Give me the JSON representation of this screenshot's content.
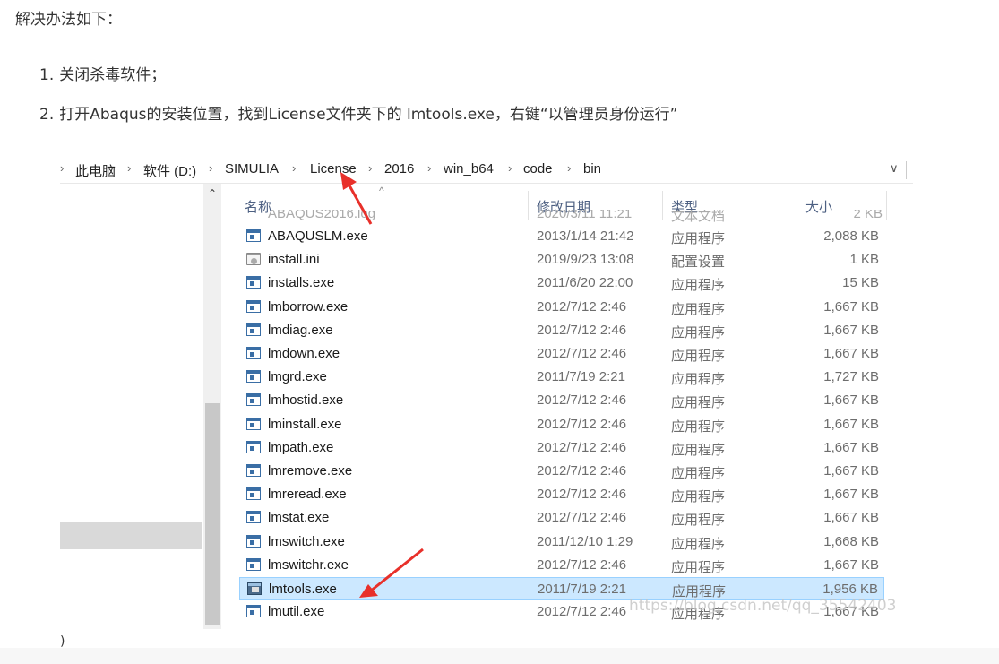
{
  "intro": "解决办法如下：",
  "steps": [
    {
      "num": "1.",
      "text": "关闭杀毒软件；"
    },
    {
      "num": "2.",
      "text": "打开Abaqus的安装位置，找到License文件夹下的 lmtools.exe，右键“以管理员身份运行”"
    }
  ],
  "address_bar": {
    "crumbs": [
      "此电脑",
      "软件 (D:)",
      "SIMULIA",
      "License",
      "2016",
      "win_b64",
      "code",
      "bin"
    ]
  },
  "columns": {
    "name": "名称",
    "date": "修改日期",
    "type": "类型",
    "size": "大小"
  },
  "ghost_row": {
    "name": "ABAQUS2016.log",
    "date": "2020/3/11 11:21",
    "type": "文本文档",
    "size": "2 KB"
  },
  "files": [
    {
      "name": "ABAQUSLM.exe",
      "date": "2013/1/14 21:42",
      "type": "应用程序",
      "size": "2,088 KB",
      "icon": "exe-icon"
    },
    {
      "name": "install.ini",
      "date": "2019/9/23 13:08",
      "type": "配置设置",
      "size": "1 KB",
      "icon": "config-file-icon"
    },
    {
      "name": "installs.exe",
      "date": "2011/6/20 22:00",
      "type": "应用程序",
      "size": "15 KB",
      "icon": "exe-icon"
    },
    {
      "name": "lmborrow.exe",
      "date": "2012/7/12 2:46",
      "type": "应用程序",
      "size": "1,667 KB",
      "icon": "exe-icon"
    },
    {
      "name": "lmdiag.exe",
      "date": "2012/7/12 2:46",
      "type": "应用程序",
      "size": "1,667 KB",
      "icon": "exe-icon"
    },
    {
      "name": "lmdown.exe",
      "date": "2012/7/12 2:46",
      "type": "应用程序",
      "size": "1,667 KB",
      "icon": "exe-icon"
    },
    {
      "name": "lmgrd.exe",
      "date": "2011/7/19 2:21",
      "type": "应用程序",
      "size": "1,727 KB",
      "icon": "exe-icon"
    },
    {
      "name": "lmhostid.exe",
      "date": "2012/7/12 2:46",
      "type": "应用程序",
      "size": "1,667 KB",
      "icon": "exe-icon"
    },
    {
      "name": "lminstall.exe",
      "date": "2012/7/12 2:46",
      "type": "应用程序",
      "size": "1,667 KB",
      "icon": "exe-icon"
    },
    {
      "name": "lmpath.exe",
      "date": "2012/7/12 2:46",
      "type": "应用程序",
      "size": "1,667 KB",
      "icon": "exe-icon"
    },
    {
      "name": "lmremove.exe",
      "date": "2012/7/12 2:46",
      "type": "应用程序",
      "size": "1,667 KB",
      "icon": "exe-icon"
    },
    {
      "name": "lmreread.exe",
      "date": "2012/7/12 2:46",
      "type": "应用程序",
      "size": "1,667 KB",
      "icon": "exe-icon"
    },
    {
      "name": "lmstat.exe",
      "date": "2012/7/12 2:46",
      "type": "应用程序",
      "size": "1,667 KB",
      "icon": "exe-icon"
    },
    {
      "name": "lmswitch.exe",
      "date": "2011/12/10 1:29",
      "type": "应用程序",
      "size": "1,668 KB",
      "icon": "exe-icon"
    },
    {
      "name": "lmswitchr.exe",
      "date": "2012/7/12 2:46",
      "type": "应用程序",
      "size": "1,667 KB",
      "icon": "exe-icon"
    },
    {
      "name": "lmtools.exe",
      "date": "2011/7/19 2:21",
      "type": "应用程序",
      "size": "1,956 KB",
      "icon": "lmtools-icon",
      "selected": true
    },
    {
      "name": "lmutil.exe",
      "date": "2012/7/12 2:46",
      "type": "应用程序",
      "size": "1,667 KB",
      "icon": "exe-icon"
    }
  ],
  "left_pane_fragment": ")",
  "watermark": "https://blog.csdn.net/qq_35542403",
  "colors": {
    "selection_bg": "#cce8ff",
    "selection_border": "#99d1ff",
    "header_text": "#4d6082",
    "annotation_arrow": "#e8302a"
  }
}
